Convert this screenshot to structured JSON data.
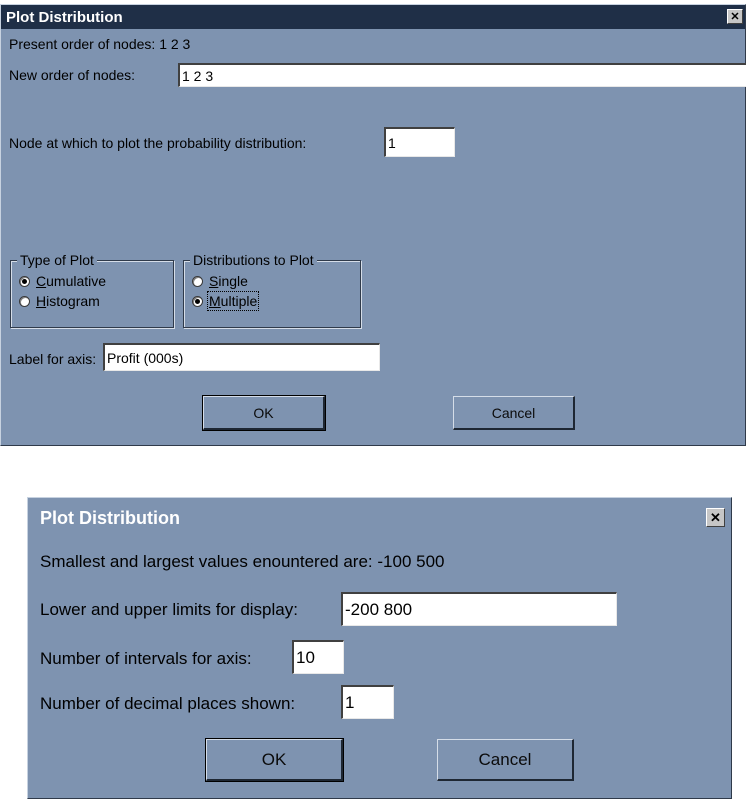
{
  "dialog1": {
    "title": "Plot Distribution",
    "close_glyph": "✕",
    "present_order": "Present order of nodes: 1 2 3",
    "new_order_label": "New order of nodes:",
    "new_order_value": "1 2 3",
    "node_label": "Node at which to plot the probability distribution:",
    "node_value": "1",
    "type_of_plot": {
      "label": "Type of Plot",
      "options": [
        {
          "mnemonic": "C",
          "rest": "umulative",
          "selected": true
        },
        {
          "mnemonic": "H",
          "rest": "istogram",
          "selected": false
        }
      ]
    },
    "distributions": {
      "label": "Distributions to Plot",
      "options": [
        {
          "mnemonic": "S",
          "rest": "ingle",
          "selected": false
        },
        {
          "mnemonic": "M",
          "rest": "ultiple",
          "selected": true
        }
      ]
    },
    "axis_label": "Label for axis:",
    "axis_value": "Profit (000s)",
    "ok": "OK",
    "cancel": "Cancel"
  },
  "dialog2": {
    "title": "Plot Distribution",
    "close_glyph": "✕",
    "smallest_largest": "Smallest and largest values enountered are: -100 500",
    "limits_label": "Lower and upper limits for display:",
    "limits_value": "-200 800",
    "intervals_label": "Number of intervals for axis:",
    "intervals_value": "10",
    "decimals_label": "Number of decimal places shown:",
    "decimals_value": "1",
    "ok": "OK",
    "cancel": "Cancel"
  },
  "colors": {
    "dialog_bg": "#7e93b0",
    "titlebar_bg": "#1f2f47"
  }
}
